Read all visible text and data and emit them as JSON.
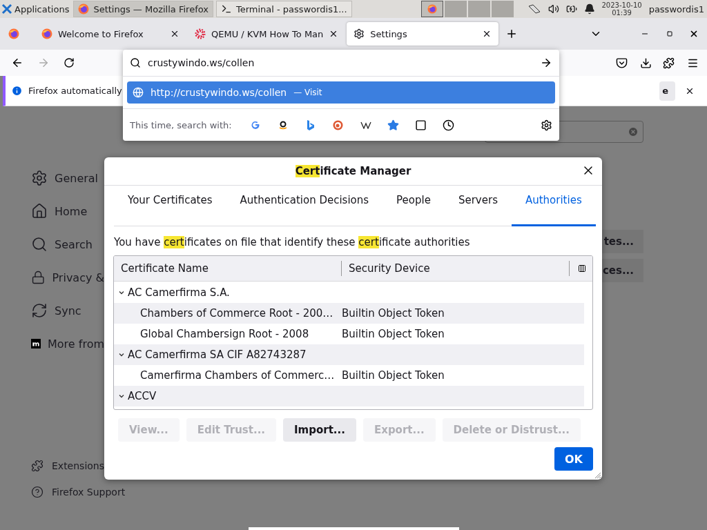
{
  "taskbar": {
    "menu": "Applications",
    "tasks": [
      {
        "title": "Settings — Mozilla Firefox",
        "selected": true,
        "kind": "browser"
      },
      {
        "title": "Terminal - passwordis1...",
        "selected": false,
        "kind": "terminal"
      }
    ],
    "workspaces": [
      {
        "selected": true
      },
      {
        "selected": false
      },
      {
        "selected": false
      },
      {
        "selected": false
      }
    ],
    "date": "2023-10-10",
    "time": "01:39",
    "user": "passwordis1"
  },
  "browser_tabs": [
    {
      "title": "Welcome to Firefox",
      "selected": false,
      "kind": "firefox"
    },
    {
      "title": "QEMU / KVM How To Man",
      "selected": false,
      "kind": "qemu"
    },
    {
      "title": "Settings",
      "selected": true,
      "kind": "settings"
    }
  ],
  "notification": {
    "text": "Firefox automatically",
    "button": "e"
  },
  "url_dropdown": {
    "value": "crustywindo.ws/collen",
    "results": [
      {
        "url": "http://crustywindo.ws/collen",
        "action": "— Visit",
        "selected": true
      }
    ],
    "search_with": "This time, search with:"
  },
  "sidebar": {
    "items": [
      {
        "label": "General",
        "kind": "gear"
      },
      {
        "label": "Home",
        "kind": "home"
      },
      {
        "label": "Search",
        "kind": "search"
      },
      {
        "label": "Privacy &",
        "kind": "lock"
      },
      {
        "label": "Sync",
        "kind": "sync"
      },
      {
        "label": "More from",
        "kind": "mozilla"
      }
    ],
    "footer": [
      {
        "label": "Extensions",
        "kind": "puzzle"
      },
      {
        "label": "Firefox Support",
        "kind": "help"
      }
    ]
  },
  "page": {
    "buttons": [
      "tes...",
      "ces..."
    ]
  },
  "dialog": {
    "title": [
      {
        "text": "Cert",
        "highlighted": true
      },
      {
        "text": "ificate Manager",
        "highlighted": false
      }
    ],
    "tabs": [
      {
        "label": "Your Certificates",
        "selected": false
      },
      {
        "label": "Authentication Decisions",
        "selected": false
      },
      {
        "label": "People",
        "selected": false
      },
      {
        "label": "Servers",
        "selected": false
      },
      {
        "label": "Authorities",
        "selected": true
      }
    ],
    "description": [
      {
        "text": "You have ",
        "highlighted": false
      },
      {
        "text": "cert",
        "highlighted": true
      },
      {
        "text": "ificates on file that identify these ",
        "highlighted": false
      },
      {
        "text": "cert",
        "highlighted": true
      },
      {
        "text": "ificate authorities",
        "highlighted": false
      }
    ],
    "columns": [
      "Certificate Name",
      "Security Device"
    ],
    "rows": [
      {
        "name": "AC Camerfirma S.A.",
        "expanded": true,
        "children": [
          {
            "name": "Chambers of Commerce Root - 200…",
            "device": "Builtin Object Token"
          },
          {
            "name": "Global Chambersign Root - 2008",
            "device": "Builtin Object Token"
          }
        ]
      },
      {
        "name": "AC Camerfirma SA CIF A82743287",
        "expanded": true,
        "children": [
          {
            "name": "Camerfirma Chambers of Commerc…",
            "device": "Builtin Object Token"
          }
        ]
      },
      {
        "name": "ACCV",
        "expanded": true
      }
    ],
    "buttons": [
      {
        "label": "View...",
        "disabled": true
      },
      {
        "label": "Edit Trust...",
        "disabled": true
      },
      {
        "label": "Import...",
        "disabled": false
      },
      {
        "label": "Export...",
        "disabled": true
      },
      {
        "label": "Delete or Distrust...",
        "disabled": true
      }
    ],
    "ok": "OK"
  }
}
